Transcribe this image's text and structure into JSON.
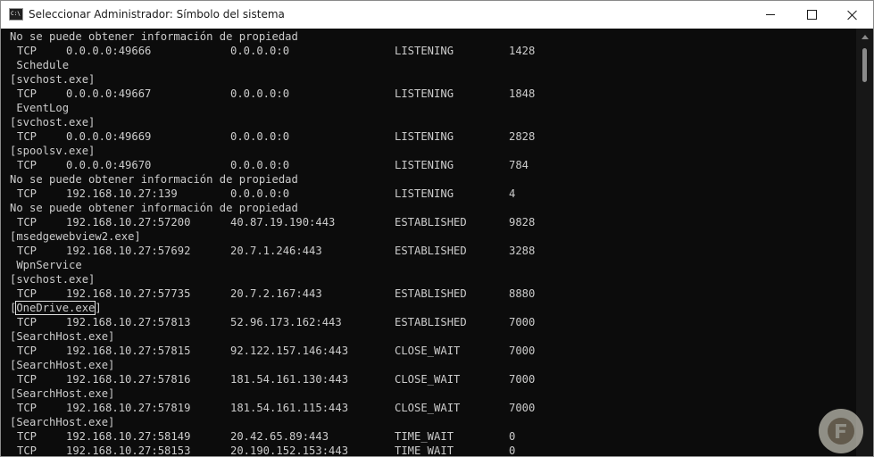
{
  "window": {
    "title": "Seleccionar Administrador: Símbolo del sistema",
    "icon_label": "C:\\"
  },
  "console": {
    "lines": [
      {
        "kind": "text",
        "text": "No se puede obtener información de propiedad"
      },
      {
        "kind": "row",
        "proto": "TCP",
        "local": "0.0.0.0:49666",
        "foreign": "0.0.0.0:0",
        "state": "LISTENING",
        "pid": "1428"
      },
      {
        "kind": "text",
        "text": " Schedule"
      },
      {
        "kind": "text",
        "text": "[svchost.exe]"
      },
      {
        "kind": "row",
        "proto": "TCP",
        "local": "0.0.0.0:49667",
        "foreign": "0.0.0.0:0",
        "state": "LISTENING",
        "pid": "1848"
      },
      {
        "kind": "text",
        "text": " EventLog"
      },
      {
        "kind": "text",
        "text": "[svchost.exe]"
      },
      {
        "kind": "row",
        "proto": "TCP",
        "local": "0.0.0.0:49669",
        "foreign": "0.0.0.0:0",
        "state": "LISTENING",
        "pid": "2828"
      },
      {
        "kind": "text",
        "text": "[spoolsv.exe]"
      },
      {
        "kind": "row",
        "proto": "TCP",
        "local": "0.0.0.0:49670",
        "foreign": "0.0.0.0:0",
        "state": "LISTENING",
        "pid": "784"
      },
      {
        "kind": "text",
        "text": "No se puede obtener información de propiedad"
      },
      {
        "kind": "row",
        "proto": "TCP",
        "local": "192.168.10.27:139",
        "foreign": "0.0.0.0:0",
        "state": "LISTENING",
        "pid": "4"
      },
      {
        "kind": "text",
        "text": "No se puede obtener información de propiedad"
      },
      {
        "kind": "row",
        "proto": "TCP",
        "local": "192.168.10.27:57200",
        "foreign": "40.87.19.190:443",
        "state": "ESTABLISHED",
        "pid": "9828"
      },
      {
        "kind": "text",
        "text": "[msedgewebview2.exe]"
      },
      {
        "kind": "row",
        "proto": "TCP",
        "local": "192.168.10.27:57692",
        "foreign": "20.7.1.246:443",
        "state": "ESTABLISHED",
        "pid": "3288"
      },
      {
        "kind": "text",
        "text": " WpnService"
      },
      {
        "kind": "text",
        "text": "[svchost.exe]"
      },
      {
        "kind": "row",
        "proto": "TCP",
        "local": "192.168.10.27:57735",
        "foreign": "20.7.2.167:443",
        "state": "ESTABLISHED",
        "pid": "8880"
      },
      {
        "kind": "selected",
        "before": "[",
        "sel": "OneDrive.exe",
        "after": "]"
      },
      {
        "kind": "row",
        "proto": "TCP",
        "local": "192.168.10.27:57813",
        "foreign": "52.96.173.162:443",
        "state": "ESTABLISHED",
        "pid": "7000"
      },
      {
        "kind": "text",
        "text": "[SearchHost.exe]"
      },
      {
        "kind": "row",
        "proto": "TCP",
        "local": "192.168.10.27:57815",
        "foreign": "92.122.157.146:443",
        "state": "CLOSE_WAIT",
        "pid": "7000"
      },
      {
        "kind": "text",
        "text": "[SearchHost.exe]"
      },
      {
        "kind": "row",
        "proto": "TCP",
        "local": "192.168.10.27:57816",
        "foreign": "181.54.161.130:443",
        "state": "CLOSE_WAIT",
        "pid": "7000"
      },
      {
        "kind": "text",
        "text": "[SearchHost.exe]"
      },
      {
        "kind": "row",
        "proto": "TCP",
        "local": "192.168.10.27:57819",
        "foreign": "181.54.161.115:443",
        "state": "CLOSE_WAIT",
        "pid": "7000"
      },
      {
        "kind": "text",
        "text": "[SearchHost.exe]"
      },
      {
        "kind": "row",
        "proto": "TCP",
        "local": "192.168.10.27:58149",
        "foreign": "20.42.65.89:443",
        "state": "TIME_WAIT",
        "pid": "0"
      },
      {
        "kind": "row",
        "proto": "TCP",
        "local": "192.168.10.27:58153",
        "foreign": "20.190.152.153:443",
        "state": "TIME_WAIT",
        "pid": "0"
      }
    ]
  },
  "colors": {
    "console_bg": "#0c0c0c",
    "console_text": "#cccccc",
    "titlebar_bg": "#ffffff"
  },
  "icons": {
    "app": "cmd-icon",
    "minimize": "minimize-icon",
    "maximize": "maximize-icon",
    "close": "close-icon",
    "scroll_up": "scroll-up-arrow-icon",
    "watermark": "site-logo-watermark"
  }
}
